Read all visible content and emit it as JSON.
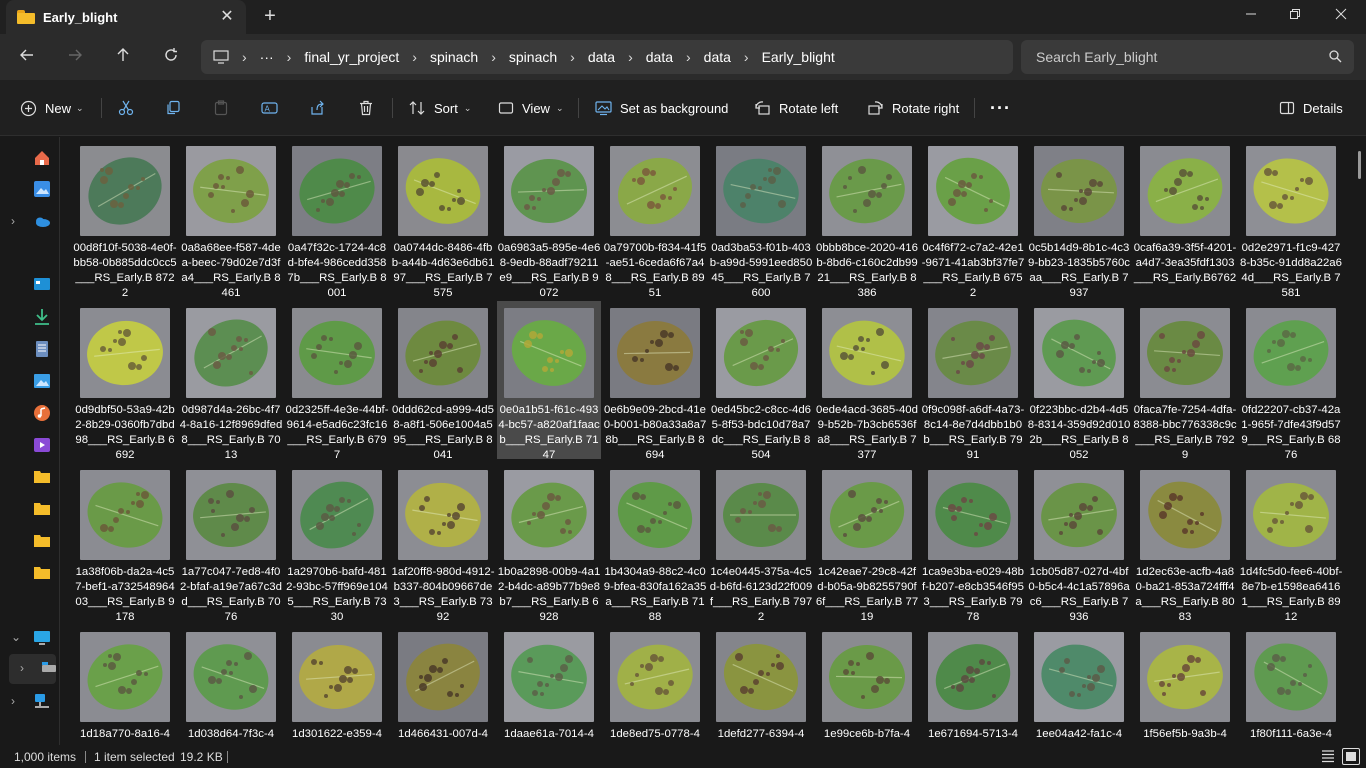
{
  "window": {
    "tab_title": "Early_blight",
    "new_tab_icon": "plus-icon",
    "controls": [
      "minimize-icon",
      "maximize-icon",
      "close-icon"
    ]
  },
  "address": {
    "crumbs": [
      "final_yr_project",
      "spinach",
      "spinach",
      "data",
      "data",
      "data",
      "Early_blight"
    ],
    "overflow": "···",
    "search_placeholder": "Search Early_blight"
  },
  "toolbar": {
    "new_label": "New",
    "sort_label": "Sort",
    "view_label": "View",
    "set_background_label": "Set as background",
    "rotate_left_label": "Rotate left",
    "rotate_right_label": "Rotate right",
    "more_label": "···",
    "details_label": "Details"
  },
  "files": [
    {
      "name": "00d8f10f-5038-4e0f-bb58-0b885ddc0cc5___RS_Early.B 8722",
      "leaf": "#4d7a5a",
      "spots": "#6b6240",
      "bg": "#8b8c90"
    },
    {
      "name": "0a8a68ee-f587-4dea-beec-79d02e7d3fa4___RS_Early.B 8461",
      "leaf": "#7fa04a",
      "spots": "#6b5a3a",
      "bg": "#9a9aa0"
    },
    {
      "name": "0a47f32c-1724-4c8d-bfe4-986cedd3587b___RS_Early.B 8001",
      "leaf": "#4f8a4a",
      "spots": "#5e5840",
      "bg": "#7d7e85"
    },
    {
      "name": "0a0744dc-8486-4fbb-a44b-4d63e6db6197___RS_Early.B 7575",
      "leaf": "#a8b840",
      "spots": "#5a5232",
      "bg": "#8a8a8f"
    },
    {
      "name": "0a6983a5-895e-4e68-9edb-88adf79211e9___RS_Early.B 9072",
      "leaf": "#5f9450",
      "spots": "#6a5b45",
      "bg": "#9a9ba3"
    },
    {
      "name": "0a79700b-f834-41f5-ae51-6ceda6f67a48___RS_Early.B 8951",
      "leaf": "#8aa848",
      "spots": "#7a5a3c",
      "bg": "#8c8d92"
    },
    {
      "name": "0ad3ba53-f01b-403b-a99d-5991eed85045___RS_Early.B 7600",
      "leaf": "#4d826a",
      "spots": "#5a6048",
      "bg": "#7a7c83"
    },
    {
      "name": "0bbb8bce-2020-416b-8bd6-c160c2db9921___RS_Early.B 8386",
      "leaf": "#6a9a4a",
      "spots": "#5b5a40",
      "bg": "#8f9096"
    },
    {
      "name": "0c4f6f72-c7a2-42e1-9671-41ab3bf37fe7___RS_Early.B 6752",
      "leaf": "#6aa048",
      "spots": "#6a5a40",
      "bg": "#9a9ba2"
    },
    {
      "name": "0c5b14d9-8b1c-4c39-bb23-1835b5760caa___RS_Early.B 7937",
      "leaf": "#7a9448",
      "spots": "#5a4a38",
      "bg": "#7f8087"
    },
    {
      "name": "0caf6a39-3f5f-4201-a4d7-3ea35fdf1303___RS_Early.B6762",
      "leaf": "#8ab048",
      "spots": "#5a5638",
      "bg": "#8a8b91"
    },
    {
      "name": "0d2e2971-f1c9-4278-b35c-91dd8a22a64d___RS_Early.B 7581",
      "leaf": "#b4c04a",
      "spots": "#6a5a3a",
      "bg": "#8e8f95"
    },
    {
      "name": "0d9dbf50-53a9-42b2-8b29-0360fb7dbd98___RS_Early.B 6692",
      "leaf": "#c0c848",
      "spots": "#6a6038",
      "bg": "#8b8c92"
    },
    {
      "name": "0d987d4a-26bc-4f74-8a16-12f8969dfed8___RS_Early.B 7013",
      "leaf": "#5c8e52",
      "spots": "#6a5c44",
      "bg": "#9a9ba1"
    },
    {
      "name": "0d2325ff-4e3e-44bf-9614-e5ad6c23fc16___RS_Early.B 6797",
      "leaf": "#5f9a48",
      "spots": "#5a5a40",
      "bg": "#8a8b90"
    },
    {
      "name": "0ddd62cd-a999-4d58-a8f1-506e1004a595___RS_Early.B 8041",
      "leaf": "#6e8a40",
      "spots": "#5a4232",
      "bg": "#84858b"
    },
    {
      "name": "0e0a1b51-f61c-4934-bc57-a820af1faacb___RS_Early.B 7147",
      "leaf": "#6aa848",
      "spots": "#b0a838",
      "bg": "#7c7d84"
    },
    {
      "name": "0e6b9e09-2bcd-41e0-b001-b80a33a8a78b___RS_Early.B 8694",
      "leaf": "#8a7a40",
      "spots": "#4a3a28",
      "bg": "#7a7b82"
    },
    {
      "name": "0ed45bc2-c8cc-4d65-8f53-bdc10d78a7dc___RS_Early.B 8504",
      "leaf": "#6a9a4a",
      "spots": "#6a5c42",
      "bg": "#9a9ba2"
    },
    {
      "name": "0ede4acd-3685-40d9-b52b-7b3cb6536fa8___RS_Early.B 7377",
      "leaf": "#b0c048",
      "spots": "#5a5638",
      "bg": "#8d8e94"
    },
    {
      "name": "0f9c098f-a6df-4a73-8c14-8e7d4dbb1b0b___RS_Early.B 7991",
      "leaf": "#6a8a48",
      "spots": "#6a4a48",
      "bg": "#84858c"
    },
    {
      "name": "0f223bbc-d2b4-4d58-8314-359d92d0102b___RS_Early.B 8052",
      "leaf": "#5f9a52",
      "spots": "#5a5a44",
      "bg": "#9a9ba1"
    },
    {
      "name": "0faca7fe-7254-4dfa-8388-bbc776338c9c___RS_Early.B 7929",
      "leaf": "#6a8a44",
      "spots": "#6a4a40",
      "bg": "#8b8c92"
    },
    {
      "name": "0fd22207-cb37-42a1-965f-7dfe43f9d579___RS_Early.B 6876",
      "leaf": "#5fa050",
      "spots": "#5a6a44",
      "bg": "#8a8b91"
    },
    {
      "name": "1a38f06b-da2a-4c57-bef1-a73254896403___RS_Early.B 9178",
      "leaf": "#6a9a48",
      "spots": "#6a5a3a",
      "bg": "#8b8c92"
    },
    {
      "name": "1a77c047-7ed8-4f02-bfaf-a19e7a67c3dd___RS_Early.B 7076",
      "leaf": "#5f8a4a",
      "spots": "#5a5040",
      "bg": "#8f9096"
    },
    {
      "name": "1a2970b6-bafd-4812-93bc-57ff969e1045___RS_Early.B 7330",
      "leaf": "#4f8a52",
      "spots": "#5a5a44",
      "bg": "#8a8b91"
    },
    {
      "name": "1af20ff8-980d-4912-b337-804b09667de3___RS_Early.B 7392",
      "leaf": "#b0b048",
      "spots": "#5a4a32",
      "bg": "#8c8d93"
    },
    {
      "name": "1b0a2898-00b9-4a12-b4dc-a89b77b9e8b7___RS_Early.B 6928",
      "leaf": "#6a9a4a",
      "spots": "#6a5a40",
      "bg": "#9a9ba2"
    },
    {
      "name": "1b4304a9-88c2-4c09-bfea-830fa162a35a___RS_Early.B 7188",
      "leaf": "#5f9a48",
      "spots": "#5a5a40",
      "bg": "#8b8c92"
    },
    {
      "name": "1c4e0445-375a-4c5d-b6fd-6123d22f009f___RS_Early.B 7972",
      "leaf": "#5a8a4a",
      "spots": "#6a5a44",
      "bg": "#8a8b90"
    },
    {
      "name": "1c42eae7-29c8-42fd-b05a-9b8255790f6f___RS_Early.B 7719",
      "leaf": "#6a9a48",
      "spots": "#5a5040",
      "bg": "#8c8d93"
    },
    {
      "name": "1ca9e3ba-e029-48bf-b207-e8cb3546f953___RS_Early.B 7978",
      "leaf": "#4f8a4a",
      "spots": "#6a4a44",
      "bg": "#84858b"
    },
    {
      "name": "1cb05d87-027d-4bf0-b5c4-4c1a57896ac6___RS_Early.B 7936",
      "leaf": "#6a9448",
      "spots": "#5a4a3a",
      "bg": "#8f9096"
    },
    {
      "name": "1d2ec63e-acfb-4a80-ba21-853a724fff4a___RS_Early.B 8083",
      "leaf": "#8a8a40",
      "spots": "#5a3a2a",
      "bg": "#8b8c92"
    },
    {
      "name": "1d4fc5d0-fee6-40bf-8e7b-e1598ea64161___RS_Early.B 8912",
      "leaf": "#a0b448",
      "spots": "#6a5a3a",
      "bg": "#8a8b91"
    },
    {
      "name": "1d18a770-8a16-4",
      "leaf": "#6aa04a",
      "spots": "#5a5a40",
      "bg": "#8b8c92"
    },
    {
      "name": "1d038d64-7f3c-4",
      "leaf": "#5f9a50",
      "spots": "#5a5a44",
      "bg": "#8f9096"
    },
    {
      "name": "1d301622-e359-4",
      "leaf": "#b0a848",
      "spots": "#5a4a30",
      "bg": "#8a8b91"
    },
    {
      "name": "1d466431-007d-4",
      "leaf": "#8a8440",
      "spots": "#4a3a28",
      "bg": "#7a7b82"
    },
    {
      "name": "1daae61a-7014-4",
      "leaf": "#5a9a5a",
      "spots": "#5a6048",
      "bg": "#9a9ba1"
    },
    {
      "name": "1de8ed75-0778-4",
      "leaf": "#a0b048",
      "spots": "#6a5a3a",
      "bg": "#8b8c92"
    },
    {
      "name": "1defd277-6394-4",
      "leaf": "#8a9440",
      "spots": "#5a4230",
      "bg": "#84858b"
    },
    {
      "name": "1e99ce6b-b7fa-4",
      "leaf": "#6a9a48",
      "spots": "#5a5038",
      "bg": "#8a8b90"
    },
    {
      "name": "1e671694-5713-4",
      "leaf": "#4f8a4a",
      "spots": "#5a4a40",
      "bg": "#8c8d93"
    },
    {
      "name": "1ee04a42-fa1c-4",
      "leaf": "#4f8a6a",
      "spots": "#5a5a48",
      "bg": "#9a9ba2"
    },
    {
      "name": "1f56ef5b-9a3b-4",
      "leaf": "#a8b448",
      "spots": "#6a4a3a",
      "bg": "#8b8c92"
    },
    {
      "name": "1f80f111-6a3e-4",
      "leaf": "#5f9a50",
      "spots": "#5a6048",
      "bg": "#8a8b91"
    }
  ],
  "selected_index": 16,
  "status": {
    "items": "1,000 items",
    "selected": "1 item selected",
    "size": "19.2 KB"
  },
  "colors": {
    "accent": "#4cc2ff",
    "folder": "#f4bc2a",
    "background": "#191919"
  }
}
